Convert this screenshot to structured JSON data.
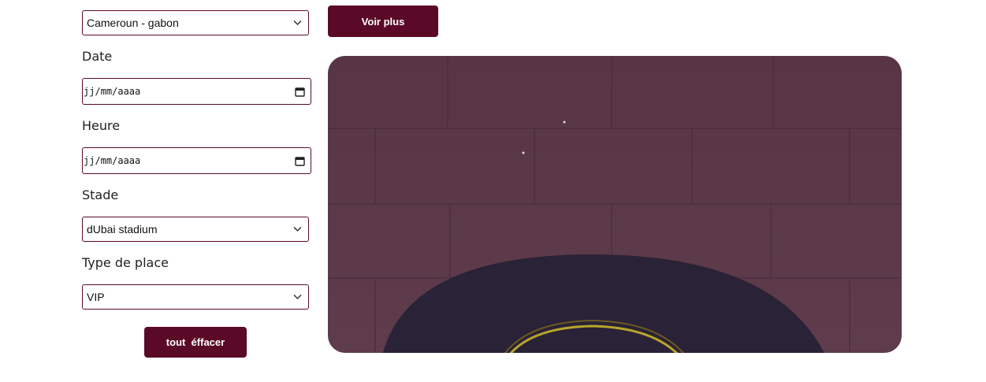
{
  "form": {
    "match_select": {
      "value": "Cameroun - gabon"
    },
    "date": {
      "label": "Date",
      "placeholder": "jj/mm/aaaa"
    },
    "heure": {
      "label": "Heure",
      "placeholder": "jj/mm/aaaa"
    },
    "stade": {
      "label": "Stade",
      "value": "dUbai stadium"
    },
    "type_place": {
      "label": "Type de place",
      "value": "VIP"
    },
    "clear_button": "tout  éffacer"
  },
  "voir_plus_button": "Voir plus",
  "colors": {
    "accent": "#5a0a26",
    "wall": "#5b3a49",
    "arch": "#2a2236"
  },
  "icons": {
    "dropdown": "chevron-down-icon",
    "date": "calendar-icon"
  }
}
